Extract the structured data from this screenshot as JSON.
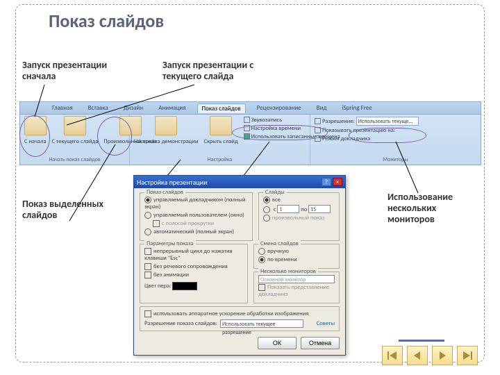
{
  "title": "Показ слайдов",
  "annotations": {
    "a1": "Запуск презентации сначала",
    "a2": "Запуск презентации с текущего слайда",
    "a3": "Показ выделенных слайдов",
    "a4": "Использование нескольких мониторов"
  },
  "ribbon": {
    "tabs": [
      "Главная",
      "Вставка",
      "Дизайн",
      "Анимация",
      "Показ слайдов",
      "Рецензирование",
      "Вид",
      "iSpring Free"
    ],
    "active_tab": "Показ слайдов",
    "group1": {
      "btn1": "С начала",
      "btn2": "С текущего слайда",
      "btn3": "Произвольный показ",
      "label": "Начать показ слайдов"
    },
    "group2": {
      "btn1": "Настройка демонстрации",
      "btn2": "Скрыть слайд",
      "chk1": "Звукозапись",
      "chk2": "Настройка времени",
      "chk3": "Использовать записанные времена",
      "label": "Настройка"
    },
    "group3": {
      "chk1": "Разрешение:",
      "chk2": "Показывать презентацию на:",
      "chk3": "Режим докладчика",
      "combo": "Использовать текуще...",
      "label": "Мониторы"
    }
  },
  "dialog": {
    "title": "Настройка презентации",
    "fs_show": {
      "legend": "Показ слайдов",
      "r1": "управляемый докладчиком (полный экран)",
      "r2": "управляемый пользователем (окно)",
      "c1": "с полосой прокрутки",
      "r3": "автоматический (полный экран)"
    },
    "fs_slides": {
      "legend": "Слайды",
      "r1": "все",
      "r2_from": "с",
      "r2_to": "по",
      "from": "1",
      "to": "15",
      "r3": "произвольный показ"
    },
    "fs_opts": {
      "legend": "Параметры показа",
      "c1": "непрерывный цикл до нажатия клавиши \"Esc\"",
      "c2": "без речевого сопровождения",
      "c3": "без анимации",
      "pen": "Цвет пера:"
    },
    "fs_adv": {
      "legend": "Смена слайдов",
      "r1": "вручную",
      "r2": "по времени",
      "mon_legend": "Несколько мониторов",
      "mon_sel": "Основной монитор",
      "mon_chk": "Показать представление докладчика"
    },
    "perf": {
      "c1": "использовать аппаратное ускорение обработки изображения",
      "res": "Разрешение показа слайдов:",
      "res_val": "Использовать текущее разрешение",
      "tips": "Советы"
    },
    "ok": "ОК",
    "cancel": "Отмена"
  }
}
